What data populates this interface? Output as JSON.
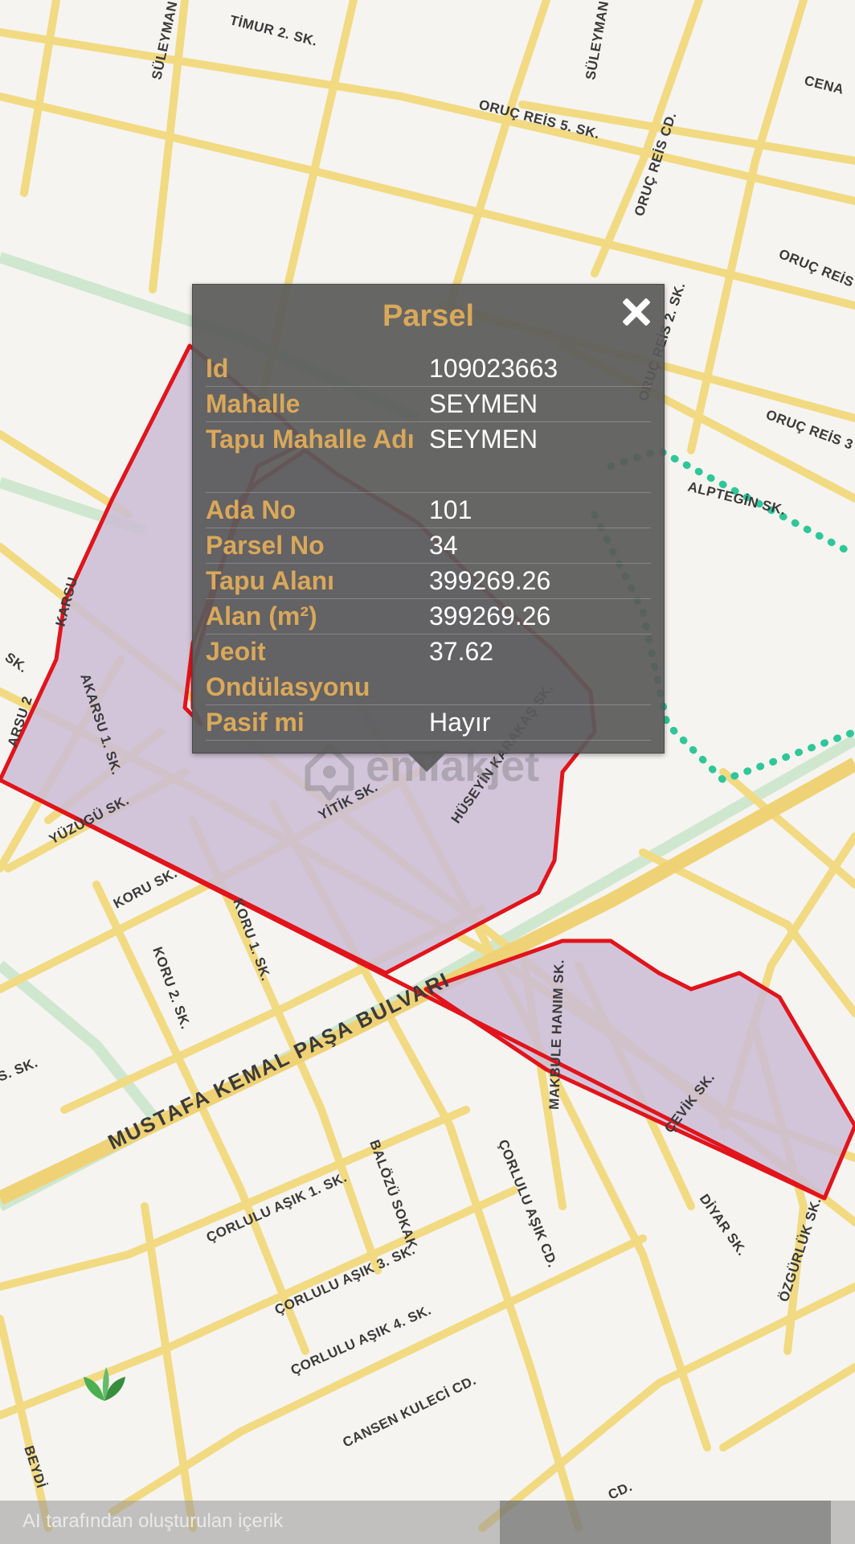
{
  "map": {
    "streets": [
      {
        "name": "SÜLEYMAN",
        "id": "suleyman-1"
      },
      {
        "name": "TİMUR 2. SK.",
        "id": "timur-2"
      },
      {
        "name": "SÜLEYMAN",
        "id": "suleyman-2"
      },
      {
        "name": "CENA",
        "id": "cena"
      },
      {
        "name": "ORUÇ REİS 5. SK.",
        "id": "oruc-reis-5"
      },
      {
        "name": "ORUÇ REİS CD.",
        "id": "oruc-reis-cd"
      },
      {
        "name": "ORUÇ REİS",
        "id": "oruc-reis"
      },
      {
        "name": "ORUÇ REİS 2. SK.",
        "id": "oruc-reis-2"
      },
      {
        "name": "ORUÇ REİS 3",
        "id": "oruc-reis-3"
      },
      {
        "name": "ALPTEGİN SK.",
        "id": "alptegin"
      },
      {
        "name": "KARSU",
        "id": "karsu"
      },
      {
        "name": "AKARSU 1. SK.",
        "id": "akarsu-1"
      },
      {
        "name": "ARSU 2",
        "id": "arsu-2"
      },
      {
        "name": "YÜZÜGÜ SK.",
        "id": "yuzugu"
      },
      {
        "name": "YİTİK SK.",
        "id": "yitik"
      },
      {
        "name": "HÜSEYİN KARAKAŞ SK.",
        "id": "huseyin-karakas"
      },
      {
        "name": "KORU SK.",
        "id": "koru"
      },
      {
        "name": "KORU 1. SK.",
        "id": "koru-1"
      },
      {
        "name": "KORU 2. SK.",
        "id": "koru-2"
      },
      {
        "name": "MUSTAFA KEMAL PAŞA BULVARI",
        "id": "mkp-bulvari"
      },
      {
        "name": "MAKBULE HANIM SK.",
        "id": "makbule-hanim"
      },
      {
        "name": "ÇEVİK SK.",
        "id": "cevik"
      },
      {
        "name": "DİYAR SK.",
        "id": "diyar"
      },
      {
        "name": "ÖZGÜRLÜK SK.",
        "id": "ozgurluk"
      },
      {
        "name": "ÇORLULU AŞIK 1. SK.",
        "id": "corlulu-asik-1"
      },
      {
        "name": "BALÖZÜ SOKAK",
        "id": "balozu"
      },
      {
        "name": "ÇORLULU AŞIK CD.",
        "id": "corlulu-asik-cd"
      },
      {
        "name": "ÇORLULU AŞIK 3. SK.",
        "id": "corlulu-asik-3"
      },
      {
        "name": "ÇORLULU AŞIK 4. SK.",
        "id": "corlulu-asik-4"
      },
      {
        "name": "CANSEN KULECİ CD.",
        "id": "cansen-kuleci"
      },
      {
        "name": "CD.",
        "id": "cd-bottom"
      },
      {
        "name": "BEYDİ",
        "id": "beydi"
      },
      {
        "name": "S. SK.",
        "id": "s-sk"
      },
      {
        "name": "SK.",
        "id": "sk-left"
      }
    ],
    "colors": {
      "road": "#f3dd86",
      "road_edge": "#e0c46a",
      "parcel_stroke": "#e2141b",
      "parcel_fill": "#cbbcd6",
      "park_dots": "#2fc79a",
      "rail": "#cfe8cf"
    }
  },
  "popup": {
    "title": "Parsel",
    "close_icon": "close-icon",
    "rows": [
      {
        "label": "Id",
        "value": "109023663"
      },
      {
        "label": "Mahalle",
        "value": "SEYMEN"
      },
      {
        "label": "Tapu Mahalle Adı",
        "value": "SEYMEN"
      },
      {
        "label": "Ada No",
        "value": "101"
      },
      {
        "label": "Parsel No",
        "value": "34"
      },
      {
        "label": "Tapu Alanı",
        "value": "399269.26"
      },
      {
        "label": "Alan (m²)",
        "value": "399269.26"
      },
      {
        "label": "Jeoit Ondülasyonu",
        "value": "37.62"
      },
      {
        "label": "Pasif mi",
        "value": "Hayır"
      }
    ]
  },
  "watermark": {
    "text": "emlakjet"
  },
  "bottom_bar": {
    "text": "AI tarafından oluşturulan içerik"
  }
}
